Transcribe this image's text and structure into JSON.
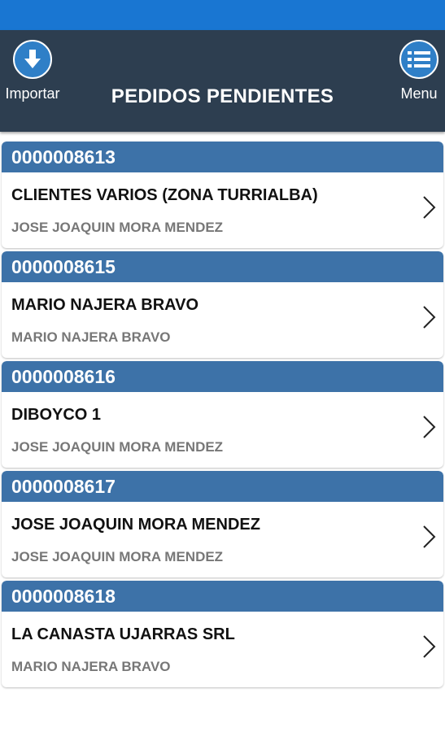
{
  "header": {
    "title": "PEDIDOS PENDIENTES",
    "import_label": "Importar",
    "menu_label": "Menu",
    "import_icon": "download-icon",
    "menu_icon": "list-icon"
  },
  "colors": {
    "status_bar": "#1976d2",
    "header_bg": "#2d3e50",
    "order_header": "#3d72a8",
    "seller_text": "#777777"
  },
  "orders": [
    {
      "number": "0000008613",
      "client": "CLIENTES VARIOS (ZONA TURRIALBA)",
      "seller": "JOSE JOAQUIN MORA MENDEZ"
    },
    {
      "number": "0000008615",
      "client": "MARIO NAJERA BRAVO",
      "seller": "MARIO NAJERA BRAVO"
    },
    {
      "number": "0000008616",
      "client": "DIBOYCO 1",
      "seller": "JOSE JOAQUIN MORA MENDEZ"
    },
    {
      "number": "0000008617",
      "client": "JOSE JOAQUIN MORA MENDEZ",
      "seller": "JOSE JOAQUIN MORA MENDEZ"
    },
    {
      "number": "0000008618",
      "client": "LA CANASTA UJARRAS SRL",
      "seller": "MARIO NAJERA BRAVO"
    }
  ]
}
